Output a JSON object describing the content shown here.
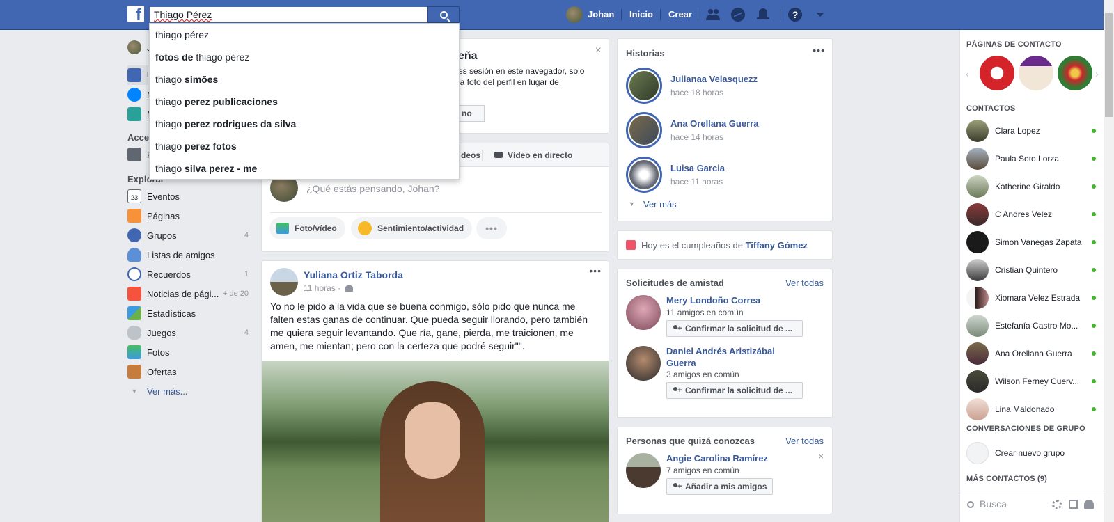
{
  "topbar": {
    "search_value": "Thiago Pérez",
    "user_name": "Johan",
    "home": "Inicio",
    "create": "Crear"
  },
  "search_suggestions": [
    {
      "pre": "thiago pérez",
      "bold": ""
    },
    {
      "pre_bold": "fotos de",
      "rest": " thiago pérez"
    },
    {
      "pre": "thiago ",
      "bold": "simões"
    },
    {
      "pre": "thiago ",
      "bold": "perez publicaciones"
    },
    {
      "pre": "thiago ",
      "bold": "perez rodrigues da silva"
    },
    {
      "pre": "thiago ",
      "bold": "perez fotos"
    },
    {
      "pre": "thiago ",
      "bold": "silva perez - me"
    }
  ],
  "left_nav": {
    "profile_initial": "J",
    "item_u": "U",
    "item_m1": "M",
    "item_m2": "M",
    "acce_heading": "Acce",
    "item_f": "F",
    "explore_heading": "Explorar",
    "items": [
      {
        "label": "Eventos",
        "count": ""
      },
      {
        "label": "Páginas",
        "count": ""
      },
      {
        "label": "Grupos",
        "count": "4"
      },
      {
        "label": "Listas de amigos",
        "count": ""
      },
      {
        "label": "Recuerdos",
        "count": "1"
      },
      {
        "label": "Noticias de pági...",
        "count": "+ de 20"
      },
      {
        "label": "Estadísticas",
        "count": ""
      },
      {
        "label": "Juegos",
        "count": "4"
      },
      {
        "label": "Fotos",
        "count": ""
      },
      {
        "label": "Ofertas",
        "count": ""
      }
    ],
    "see_more": "Ver más..."
  },
  "password_card": {
    "title_frag": "eña",
    "line1": "es sesión en este navegador, solo",
    "line2": "la foto del perfil en lugar de",
    "btn_frag": "no"
  },
  "composer": {
    "tab_videos_frag": "deos",
    "tab_live": "Vídeo en directo",
    "placeholder": "¿Qué estás pensando, Johan?",
    "btn_photo": "Foto/vídeo",
    "btn_feeling": "Sentimiento/actividad"
  },
  "post": {
    "author": "Yuliana Ortiz Taborda",
    "time": "11 horas",
    "text": "Yo no le pido a la vida que se buena conmigo, sólo pido que nunca me falten estas ganas de continuar. Que pueda seguir llorando, pero también me quiera seguir levantando. Que ría, gane, pierda, me traicionen, me amen, me mientan; pero con la certeza que podré seguir\"\"."
  },
  "stories": {
    "title": "Historias",
    "items": [
      {
        "name": "Julianaa Velasquezz",
        "time": "hace 18 horas"
      },
      {
        "name": "Ana Orellana Guerra",
        "time": "hace 14 horas"
      },
      {
        "name": "Luisa Garcia",
        "time": "hace 11 horas"
      }
    ],
    "see_more": "Ver más"
  },
  "birthday": {
    "text": "Hoy es el cumpleaños de ",
    "name": "Tiffany Gómez"
  },
  "friend_requests": {
    "title": "Solicitudes de amistad",
    "see_all": "Ver todas",
    "items": [
      {
        "name": "Mery Londoño Correa",
        "mutual": "11 amigos en común",
        "btn": "Confirmar la solicitud de ..."
      },
      {
        "name_line1": "Daniel Andrés Aristizábal",
        "name_line2": "Guerra",
        "mutual": "3 amigos en común",
        "btn": "Confirmar la solicitud de ..."
      }
    ]
  },
  "pymk": {
    "title": "Personas que quizá conozcas",
    "see_all": "Ver todas",
    "name": "Angie Carolina Ramírez",
    "mutual": "7 amigos en común",
    "btn": "Añadir a mis amigos"
  },
  "chat": {
    "pages_heading": "PÁGINAS DE CONTACTO",
    "contacts_heading": "CONTACTOS",
    "contacts": [
      "Clara Lopez",
      "Paula Soto Lorza",
      "Katherine Giraldo",
      "C Andres Velez",
      "Simon Vanegas Zapata",
      "Cristian Quintero",
      "Xiomara Velez Estrada",
      "Estefanía Castro Mo...",
      "Ana Orellana Guerra",
      "Wilson Ferney Cuerv...",
      "Lina Maldonado"
    ],
    "groups_heading": "CONVERSACIONES DE GRUPO",
    "new_group": "Crear nuevo grupo",
    "more_contacts": "MÁS CONTACTOS (9)",
    "search_placeholder": "Busca"
  },
  "colors": {
    "brand_blue": "#4267b2",
    "link_blue": "#385898",
    "online_green": "#42b72a"
  }
}
